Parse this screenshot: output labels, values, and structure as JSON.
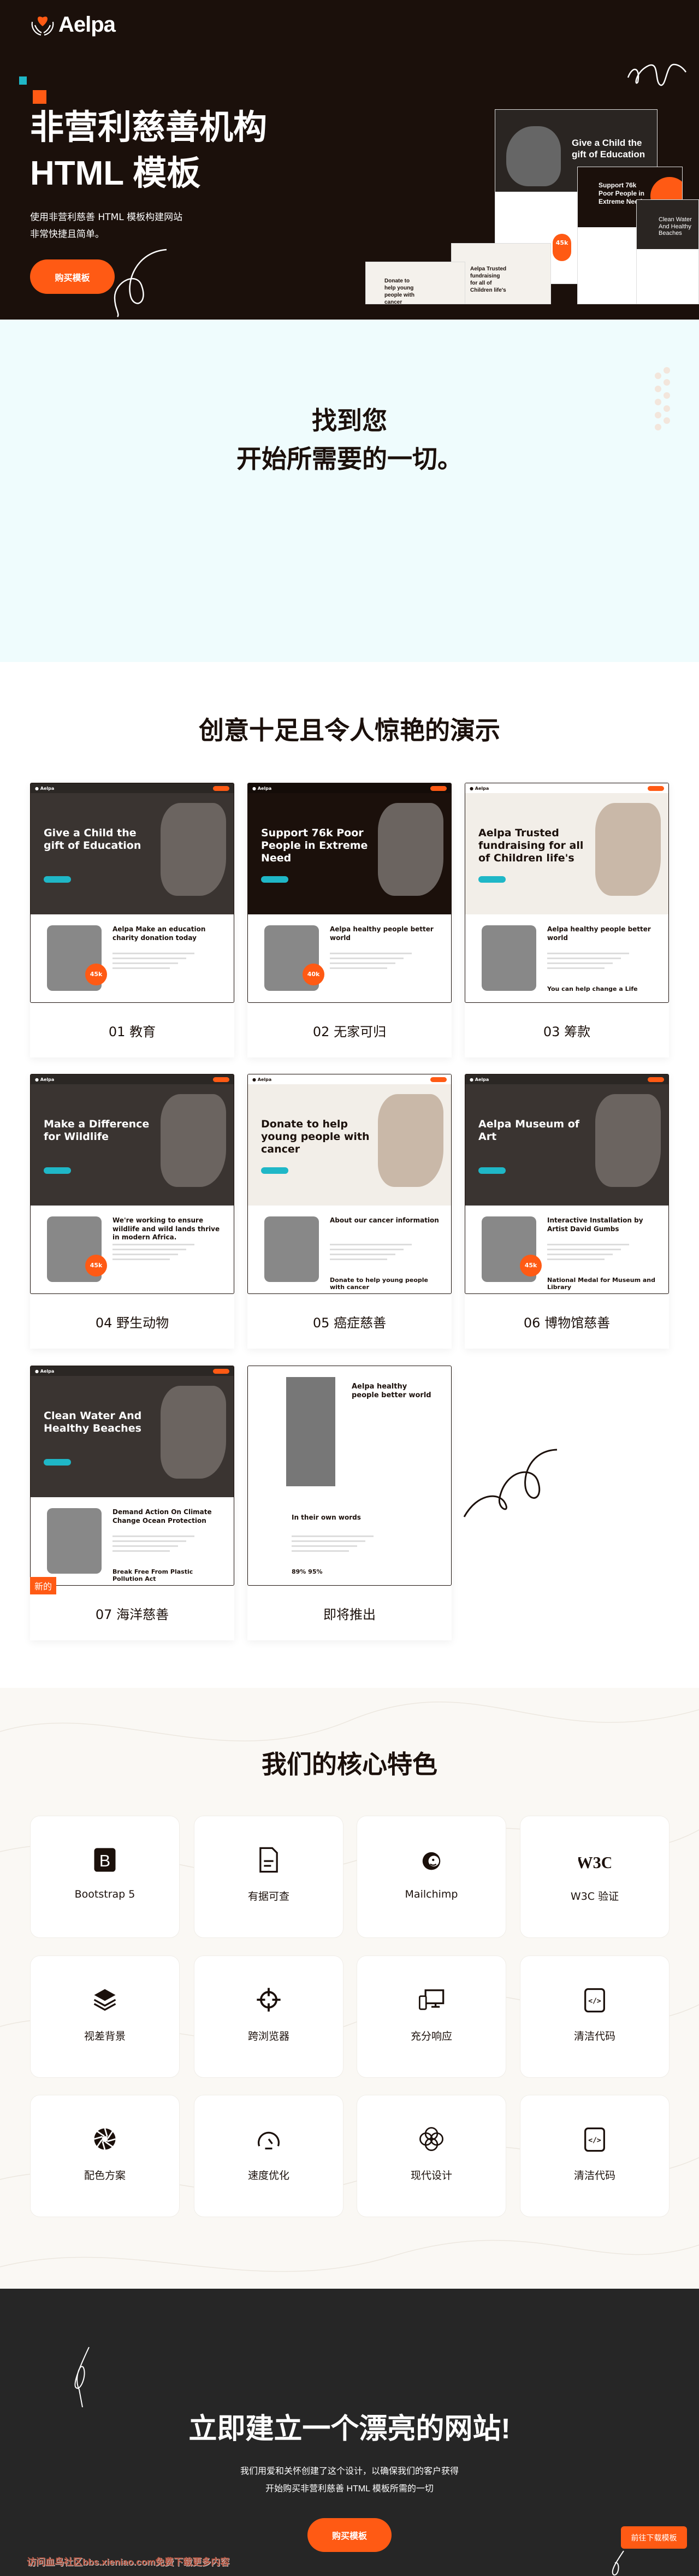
{
  "colors": {
    "accent": "#ff5a14",
    "dark": "#1b100b",
    "teal": "#1fb7c7",
    "light_cyan": "#effcfd"
  },
  "hero": {
    "logo": "Aelpa",
    "title_line1": "非营利慈善机构",
    "title_line2": "HTML 模板",
    "subtitle_line1": "使用非营利慈善 HTML 模板构建网站",
    "subtitle_line2": "非常快捷且简单。",
    "buy_button": "购买模板",
    "mockups": {
      "m1": "Give a Child the gift of Education",
      "m2": "Support 76k Poor People in Extreme Need",
      "m3": "Clean Water And Healthy Beaches",
      "m4": "Aelpa Trusted fundraising for all of Children life's",
      "m5": "Donate to help young people with cancer",
      "stat": "45k"
    }
  },
  "find": {
    "line1": "找到您",
    "line2": "开始所需要的一切。"
  },
  "demos": {
    "heading": "创意十足且令人惊艳的演示",
    "new_badge": "新的",
    "items": [
      {
        "label": "01 教育",
        "headline": "Give a Child the gift of Education",
        "body": "Aelpa Make an education charity donation today",
        "theme": "dark",
        "stat": "45k"
      },
      {
        "label": "02 无家可归",
        "headline": "Support 76k Poor People in Extreme Need",
        "body": "Aelpa healthy people better world",
        "theme": "black",
        "stat": "40k"
      },
      {
        "label": "03 筹款",
        "headline": "Aelpa Trusted fundraising for all of Children life's",
        "body": "Aelpa healthy people better world",
        "extra": "You can help change a Life",
        "theme": "beige"
      },
      {
        "label": "04 野生动物",
        "headline": "Make a Difference for Wildlife",
        "body": "We're working to ensure wildlife and wild lands thrive in modern Africa.",
        "theme": "dark",
        "stat": "45k"
      },
      {
        "label": "05 癌症慈善",
        "headline": "Donate to help young people with cancer",
        "body": "About our cancer information",
        "extra": "Donate to help young people with cancer",
        "theme": "beige"
      },
      {
        "label": "06 博物馆慈善",
        "headline": "Aelpa Museum of Art",
        "body": "Interactive Installation by Artist David Gumbs",
        "extra": "National Medal for Museum and Library",
        "theme": "dark",
        "stat": "45k"
      },
      {
        "label": "07 海洋慈善",
        "headline": "Clean Water And Healthy Beaches",
        "body": "Demand Action On Climate Change Ocean Protection",
        "extra": "Break Free From Plastic Pollution Act",
        "theme": "dark",
        "is_new": true
      },
      {
        "label": "即将推出",
        "headline": "Aelpa healthy people better world",
        "body": "In their own words",
        "extra": "89%   95%",
        "theme": "white"
      }
    ]
  },
  "features": {
    "heading": "我们的核心特色",
    "items": [
      {
        "label": "Bootstrap 5",
        "icon": "bootstrap-icon"
      },
      {
        "label": "有据可查",
        "icon": "document-icon"
      },
      {
        "label": "Mailchimp",
        "icon": "mailchimp-icon"
      },
      {
        "label": "W3C 验证",
        "icon": "w3c-icon"
      },
      {
        "label": "视差背景",
        "icon": "layers-icon"
      },
      {
        "label": "跨浏览器",
        "icon": "crosshair-icon"
      },
      {
        "label": "充分响应",
        "icon": "devices-icon"
      },
      {
        "label": "清洁代码",
        "icon": "code-icon"
      },
      {
        "label": "配色方案",
        "icon": "aperture-icon"
      },
      {
        "label": "速度优化",
        "icon": "speedometer-icon"
      },
      {
        "label": "现代设计",
        "icon": "circles-icon"
      },
      {
        "label": "清洁代码",
        "icon": "code-icon"
      }
    ]
  },
  "cta": {
    "heading": "立即建立一个漂亮的网站!",
    "text_line1": "我们用爱和关怀创建了这个设计，以确保我们的客户获得",
    "text_line2": "开始购买非营利慈善 HTML 模板所需的一切",
    "buy_button": "购买模板",
    "download_button": "前往下载模板",
    "watermark": "访问血鸟社区bbs.xieniao.com免费下载更多内容"
  }
}
